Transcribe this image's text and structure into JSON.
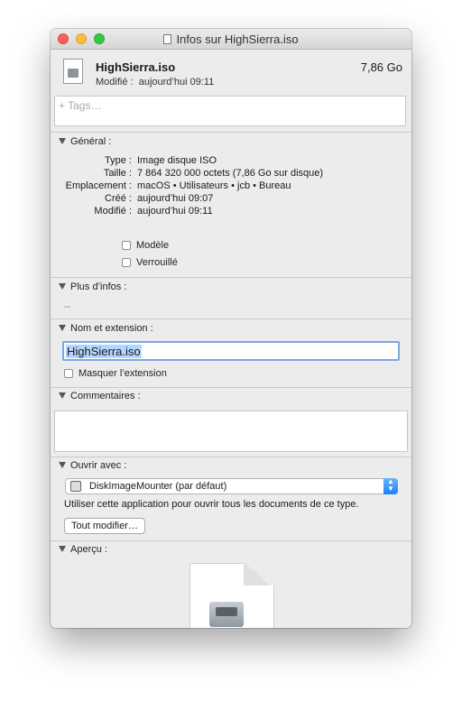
{
  "window": {
    "title": "Infos sur HighSierra.iso"
  },
  "file": {
    "name": "HighSierra.iso",
    "size": "7,86 Go",
    "modified_label": "Modifié :",
    "modified_value": "aujourd’hui 09:11"
  },
  "tags": {
    "placeholder": "+ Tags…"
  },
  "general": {
    "header": "Général :",
    "rows": [
      {
        "label": "Type :",
        "value": "Image disque ISO"
      },
      {
        "label": "Taille :",
        "value": "7 864 320 000 octets (7,86 Go sur disque)"
      },
      {
        "label": "Emplacement :",
        "value": "macOS • Utilisateurs • jcb • Bureau"
      },
      {
        "label": "Créé :",
        "value": "aujourd’hui 09:07"
      },
      {
        "label": "Modifié :",
        "value": "aujourd’hui 09:11"
      }
    ],
    "stationery_label": "Modèle",
    "locked_label": "Verrouillé"
  },
  "more_info": {
    "header": "Plus d’infos :",
    "value": "--"
  },
  "name_ext": {
    "header": "Nom et extension :",
    "value": "HighSierra.iso",
    "hide_ext_label": "Masquer l’extension"
  },
  "comments": {
    "header": "Commentaires :"
  },
  "open_with": {
    "header": "Ouvrir avec :",
    "selected": "DiskImageMounter (par défaut)",
    "hint": "Utiliser cette application pour ouvrir tous les documents de ce type.",
    "change_all": "Tout modifier…"
  },
  "preview": {
    "header": "Aperçu :"
  }
}
